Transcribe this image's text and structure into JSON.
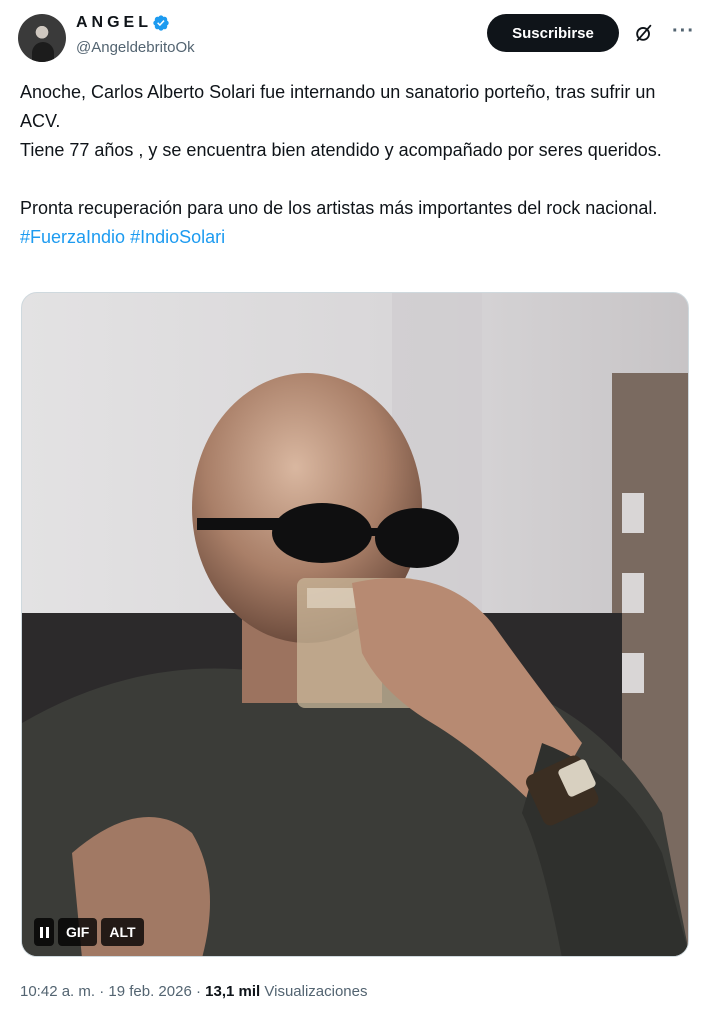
{
  "author": {
    "display_name": "ANGEL",
    "handle": "@AngeldebritoOk",
    "verified": true
  },
  "header": {
    "subscribe_label": "Suscribirse",
    "grok_icon": "grok-icon",
    "more_label": "···"
  },
  "tweet": {
    "line1": "Anoche, Carlos Alberto Solari fue internando un sanatorio porteño, tras sufrir un ACV.",
    "line2": "Tiene 77 años , y se encuentra bien atendido y acompañado por seres queridos.",
    "line3_text": "Pronta recuperación para uno de los artistas más importantes del rock nacional. ",
    "hashtag1": "#FuerzaIndio",
    "hashtag2": "#IndioSolari"
  },
  "media": {
    "gif_label": "GIF",
    "alt_label": "ALT"
  },
  "meta": {
    "time": "10:42 a. m.",
    "separator": " · ",
    "date": "19 feb. 2026",
    "views_count": "13,1 mil",
    "views_label": "Visualizaciones"
  },
  "colors": {
    "accent": "#1d9bf0",
    "text": "#0f1419",
    "muted": "#536471"
  }
}
